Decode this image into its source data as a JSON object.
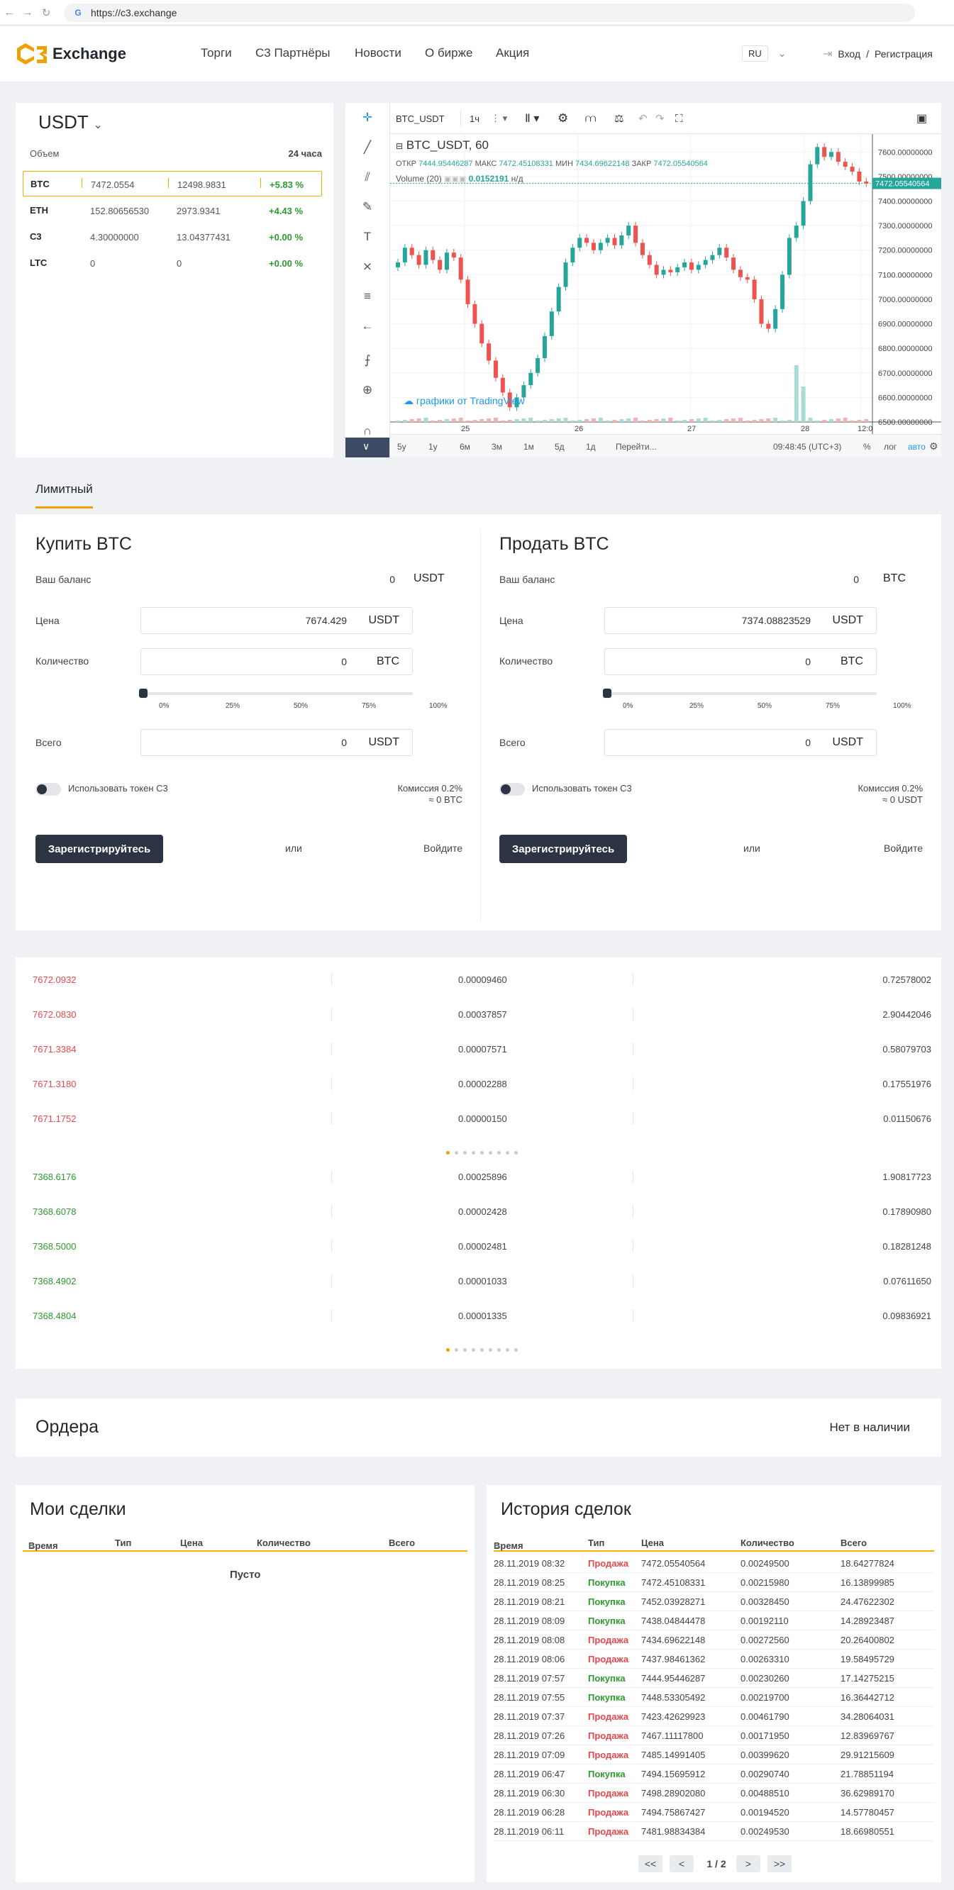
{
  "browser": {
    "url": "https://c3.exchange",
    "back": "←",
    "forward": "→",
    "reload": "C"
  },
  "header": {
    "logo_text": "Exchange",
    "nav": [
      "Торги",
      "С3 Партнёры",
      "Новости",
      "О бирже",
      "Акция"
    ],
    "lang": "RU",
    "login": "Вход",
    "slash": "/",
    "register": "Регистрация"
  },
  "market": {
    "currency": "USDT",
    "col_volume": "Объем",
    "col_24h": "24 часа",
    "rows": [
      {
        "coin": "BTC",
        "price": "7472.0554",
        "volume": "12498.9831",
        "change": "+5.83 %"
      },
      {
        "coin": "ETH",
        "price": "152.80656530",
        "volume": "2973.9341",
        "change": "+4.43 %"
      },
      {
        "coin": "C3",
        "price": "4.30000000",
        "volume": "13.04377431",
        "change": "+0.00 %"
      },
      {
        "coin": "LTC",
        "price": "0",
        "volume": "0",
        "change": "+0.00 %"
      }
    ]
  },
  "chart": {
    "symbol": "BTC_USDT",
    "interval": "1ч",
    "legend_title": "BTC_USDT, 60",
    "open_lbl": "ОТКР",
    "open": "7444.95446287",
    "high_lbl": "МАКС",
    "high": "7472.45108331",
    "low_lbl": "МИН",
    "low": "7434.69622148",
    "close_lbl": "ЗАКР",
    "close": "7472.05540564",
    "volume_lbl": "Volume (20)",
    "volume_val": "0.0152191",
    "volume_na": "н/д",
    "watermark": "графики от TradingView",
    "last_price": "7472.05540564",
    "y_ticks": [
      "7600.00000000",
      "7500.00000000",
      "7400.00000000",
      "7300.00000000",
      "7200.00000000",
      "7100.00000000",
      "7000.00000000",
      "6900.00000000",
      "6800.00000000",
      "6700.00000000",
      "6600.00000000",
      "6500.00000000"
    ],
    "x_ticks": [
      "25",
      "26",
      "27",
      "28",
      "12:0"
    ],
    "ranges": [
      "5y",
      "1y",
      "6м",
      "3м",
      "1м",
      "5д",
      "1д",
      "Перейти..."
    ],
    "time": "09:48:45 (UTC+3)",
    "pct": "%",
    "log": "лог",
    "auto": "авто",
    "colors": {
      "up": "#26a69a",
      "down": "#ef5350"
    }
  },
  "chart_data": {
    "type": "candlestick",
    "ylim": [
      6500,
      7650
    ],
    "x_ticks": [
      "25",
      "26",
      "27",
      "28",
      "12:0"
    ],
    "last": 7472.05540564,
    "closes": [
      7150,
      7210,
      7180,
      7140,
      7200,
      7160,
      7120,
      7190,
      7170,
      7080,
      6980,
      6900,
      6820,
      6750,
      6680,
      6620,
      6560,
      6600,
      6650,
      6700,
      6760,
      6850,
      6950,
      7050,
      7150,
      7210,
      7250,
      7230,
      7200,
      7230,
      7250,
      7220,
      7260,
      7300,
      7230,
      7180,
      7140,
      7100,
      7120,
      7110,
      7130,
      7150,
      7120,
      7140,
      7160,
      7180,
      7210,
      7170,
      7120,
      7090,
      7080,
      7000,
      6900,
      6880,
      6960,
      7100,
      7250,
      7300,
      7400,
      7550,
      7620,
      7580,
      7600,
      7560,
      7540,
      7520,
      7480,
      7472
    ]
  },
  "trade": {
    "tab": "Лимитный",
    "or": "или",
    "login": "Войдите",
    "register": "Зарегистрируйтесь",
    "use_token": "Использовать токен С3",
    "ticks": [
      "0%",
      "25%",
      "50%",
      "75%",
      "100%"
    ],
    "buy": {
      "title": "Купить BTC",
      "balance_lbl": "Ваш баланс",
      "balance": "0",
      "balance_unit": "USDT",
      "price_lbl": "Цена",
      "price": "7674.429",
      "price_unit": "USDT",
      "qty_lbl": "Количество",
      "qty": "0",
      "qty_unit": "BTC",
      "total_lbl": "Всего",
      "total": "0",
      "total_unit": "USDT",
      "fee1": "Комиссия 0.2%",
      "fee2": "≈ 0 BTC"
    },
    "sell": {
      "title": "Продать BTC",
      "balance_lbl": "Ваш баланс",
      "balance": "0",
      "balance_unit": "BTC",
      "price_lbl": "Цена",
      "price": "7374.08823529",
      "price_unit": "USDT",
      "qty_lbl": "Количество",
      "qty": "0",
      "qty_unit": "BTC",
      "total_lbl": "Всего",
      "total": "0",
      "total_unit": "USDT",
      "fee1": "Комиссия 0.2%",
      "fee2": "≈ 0 USDT"
    }
  },
  "book": {
    "asks": [
      {
        "price": "7672.0932",
        "amount": "0.00009460",
        "total": "0.72578002"
      },
      {
        "price": "7672.0830",
        "amount": "0.00037857",
        "total": "2.90442046"
      },
      {
        "price": "7671.3384",
        "amount": "0.00007571",
        "total": "0.58079703"
      },
      {
        "price": "7671.3180",
        "amount": "0.00002288",
        "total": "0.17551976"
      },
      {
        "price": "7671.1752",
        "amount": "0.00000150",
        "total": "0.01150676"
      }
    ],
    "bids": [
      {
        "price": "7368.6176",
        "amount": "0.00025896",
        "total": "1.90817723"
      },
      {
        "price": "7368.6078",
        "amount": "0.00002428",
        "total": "0.17890980"
      },
      {
        "price": "7368.5000",
        "amount": "0.00002481",
        "total": "0.18281248"
      },
      {
        "price": "7368.4902",
        "amount": "0.00001033",
        "total": "0.07611650"
      },
      {
        "price": "7368.4804",
        "amount": "0.00001335",
        "total": "0.09836921"
      }
    ]
  },
  "orders": {
    "title": "Ордера",
    "empty": "Нет в наличии"
  },
  "mydeals": {
    "title": "Мои сделки",
    "cols": [
      "Время",
      "Тип",
      "Цена",
      "Количество",
      "Всего"
    ],
    "empty": "Пусто"
  },
  "history": {
    "title": "История сделок",
    "cols": [
      "Время",
      "Тип",
      "Цена",
      "Количество",
      "Всего"
    ],
    "rows": [
      [
        "28.11.2019 08:32",
        "Продажа",
        "7472.05540564",
        "0.00249500",
        "18.64277824"
      ],
      [
        "28.11.2019 08:25",
        "Покупка",
        "7472.45108331",
        "0.00215980",
        "16.13899985"
      ],
      [
        "28.11.2019 08:21",
        "Покупка",
        "7452.03928271",
        "0.00328450",
        "24.47622302"
      ],
      [
        "28.11.2019 08:09",
        "Покупка",
        "7438.04844478",
        "0.00192110",
        "14.28923487"
      ],
      [
        "28.11.2019 08:08",
        "Продажа",
        "7434.69622148",
        "0.00272560",
        "20.26400802"
      ],
      [
        "28.11.2019 08:06",
        "Продажа",
        "7437.98461362",
        "0.00263310",
        "19.58495729"
      ],
      [
        "28.11.2019 07:57",
        "Покупка",
        "7444.95446287",
        "0.00230260",
        "17.14275215"
      ],
      [
        "28.11.2019 07:55",
        "Покупка",
        "7448.53305492",
        "0.00219700",
        "16.36442712"
      ],
      [
        "28.11.2019 07:37",
        "Продажа",
        "7423.42629923",
        "0.00461790",
        "34.28064031"
      ],
      [
        "28.11.2019 07:26",
        "Продажа",
        "7467.11117800",
        "0.00171950",
        "12.83969767"
      ],
      [
        "28.11.2019 07:09",
        "Продажа",
        "7485.14991405",
        "0.00399620",
        "29.91215609"
      ],
      [
        "28.11.2019 06:47",
        "Покупка",
        "7494.15695912",
        "0.00290740",
        "21.78851194"
      ],
      [
        "28.11.2019 06:30",
        "Продажа",
        "7498.28902080",
        "0.00488510",
        "36.62989170"
      ],
      [
        "28.11.2019 06:28",
        "Продажа",
        "7494.75867427",
        "0.00194520",
        "14.57780457"
      ],
      [
        "28.11.2019 06:11",
        "Продажа",
        "7481.98834384",
        "0.00249530",
        "18.66980551"
      ]
    ],
    "pager": {
      "first": "<<",
      "prev": "<",
      "page": "1 / 2",
      "next": ">",
      "last": ">>"
    }
  },
  "colors": {
    "accent": "#f0a100",
    "buy": "#2d9b2d",
    "sell": "#e5484d",
    "dark": "#2c3444"
  }
}
